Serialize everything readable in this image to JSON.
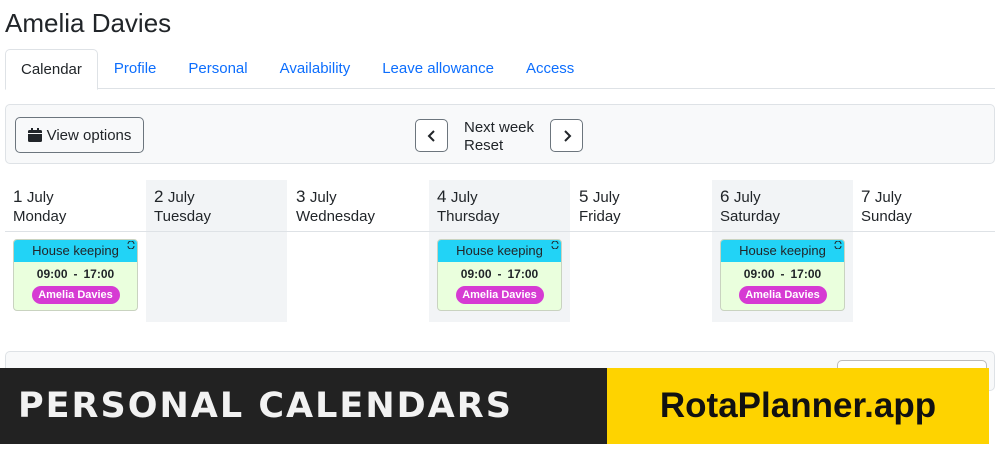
{
  "page_title": "Amelia Davies",
  "tabs": [
    {
      "label": "Calendar",
      "active": true
    },
    {
      "label": "Profile"
    },
    {
      "label": "Personal"
    },
    {
      "label": "Availability"
    },
    {
      "label": "Leave allowance"
    },
    {
      "label": "Access"
    }
  ],
  "toolbar": {
    "view_options_label": "View options",
    "next_week_label": "Next week",
    "reset_label": "Reset",
    "prev_icon": "chevron-left-icon",
    "next_icon": "chevron-right-icon",
    "calendar_icon": "calendar-icon"
  },
  "days": [
    {
      "num": "1",
      "month": "July",
      "name": "Monday"
    },
    {
      "num": "2",
      "month": "July",
      "name": "Tuesday"
    },
    {
      "num": "3",
      "month": "July",
      "name": "Wednesday"
    },
    {
      "num": "4",
      "month": "July",
      "name": "Thursday"
    },
    {
      "num": "5",
      "month": "July",
      "name": "Friday"
    },
    {
      "num": "6",
      "month": "July",
      "name": "Saturday"
    },
    {
      "num": "7",
      "month": "July",
      "name": "Sunday"
    }
  ],
  "shifts": [
    {
      "day": "Monday",
      "title": "House keeping",
      "start": "09:00",
      "sep": "-",
      "end": "17:00",
      "person": "Amelia Davies"
    },
    {
      "day": "Thursday",
      "title": "House keeping",
      "start": "09:00",
      "sep": "-",
      "end": "17:00",
      "person": "Amelia Davies"
    },
    {
      "day": "Saturday",
      "title": "House keeping",
      "start": "09:00",
      "sep": "-",
      "end": "17:00",
      "person": "Amelia Davies"
    }
  ],
  "colors": {
    "shift_header": "#22d3f6",
    "shift_body": "#eaffdd",
    "person_badge": "#d63bd3",
    "banner_dark": "#222222",
    "banner_yellow": "#fed300",
    "link": "#0d6efd"
  },
  "banner": {
    "left_text": "PERSONAL CALENDARS",
    "right_text": "RotaPlanner.app"
  }
}
